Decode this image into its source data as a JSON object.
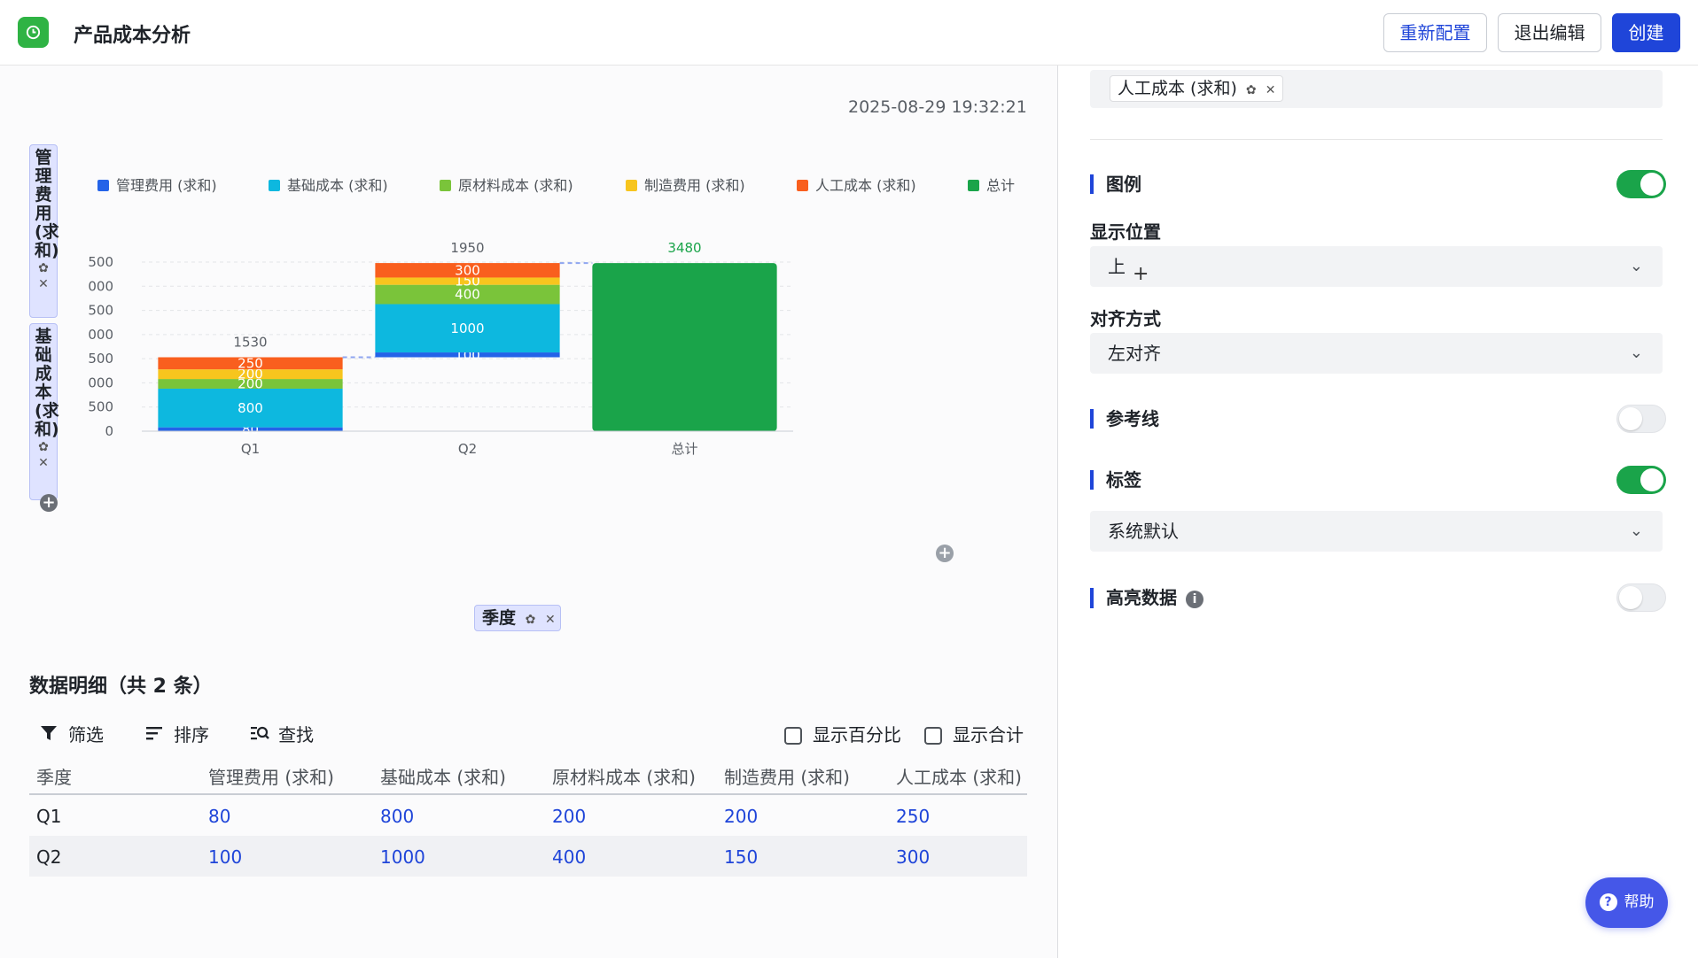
{
  "header": {
    "title": "产品成本分析",
    "buttons": {
      "reconfig": "重新配置",
      "exit_edit": "退出编辑",
      "create": "创建"
    }
  },
  "main": {
    "timestamp": "2025-08-29 19:32:21",
    "y_chips": [
      {
        "label": "管理费用(求和)"
      },
      {
        "label": "基础成本(求和)"
      }
    ],
    "x_chip": {
      "label": "季度"
    },
    "chip_gear": "✿",
    "chip_close": "✕",
    "add_symbol": "+"
  },
  "colors": {
    "管理费用": "#2463e8",
    "基础成本": "#0db8df",
    "原材料成本": "#7ac43a",
    "制造费用": "#f7c51e",
    "人工成本": "#f95f1e",
    "总计": "#1aa44a"
  },
  "chart_data": {
    "type": "bar",
    "subtype": "stacked-waterfall",
    "categories": [
      "Q1",
      "Q2",
      "总计"
    ],
    "series": [
      {
        "name": "管理费用 (求和)",
        "values": [
          80,
          100,
          null
        ]
      },
      {
        "name": "基础成本 (求和)",
        "values": [
          800,
          1000,
          null
        ]
      },
      {
        "name": "原材料成本 (求和)",
        "values": [
          200,
          400,
          null
        ]
      },
      {
        "name": "制造费用 (求和)",
        "values": [
          200,
          150,
          null
        ]
      },
      {
        "name": "人工成本 (求和)",
        "values": [
          250,
          300,
          null
        ]
      },
      {
        "name": "总计",
        "values": [
          null,
          null,
          3480
        ]
      }
    ],
    "bar_totals": [
      "1530",
      "1950",
      "3480"
    ],
    "y_ticks": [
      "0",
      "500",
      "1,000",
      "1,500",
      "2,000",
      "2,500",
      "3,000",
      "3,500"
    ],
    "ylim": [
      0,
      3500
    ],
    "legend_position": "top-left",
    "grid": true
  },
  "detail": {
    "title": "数据明细（共 2 条）",
    "toolbar": {
      "filter": "筛选",
      "sort": "排序",
      "find": "查找"
    },
    "checks": {
      "percent": "显示百分比",
      "total": "显示合计"
    },
    "columns": [
      "季度",
      "管理费用 (求和)",
      "基础成本 (求和)",
      "原材料成本 (求和)",
      "制造费用 (求和)",
      "人工成本 (求和)"
    ],
    "rows": [
      [
        "Q1",
        "80",
        "800",
        "200",
        "200",
        "250"
      ],
      [
        "Q2",
        "100",
        "1000",
        "400",
        "150",
        "300"
      ]
    ]
  },
  "panel": {
    "tag_label": "人工成本 (求和)",
    "legend_title": "图例",
    "legend_on": true,
    "position_label": "显示位置",
    "position_value": "上",
    "align_label": "对齐方式",
    "align_value": "左对齐",
    "refline_title": "参考线",
    "refline_on": false,
    "label_title": "标签",
    "label_on": true,
    "label_value": "系统默认",
    "highlight_title": "高亮数据",
    "highlight_on": false,
    "chevron": "⌄",
    "info": "i"
  },
  "help": {
    "label": "帮助",
    "q": "?"
  }
}
